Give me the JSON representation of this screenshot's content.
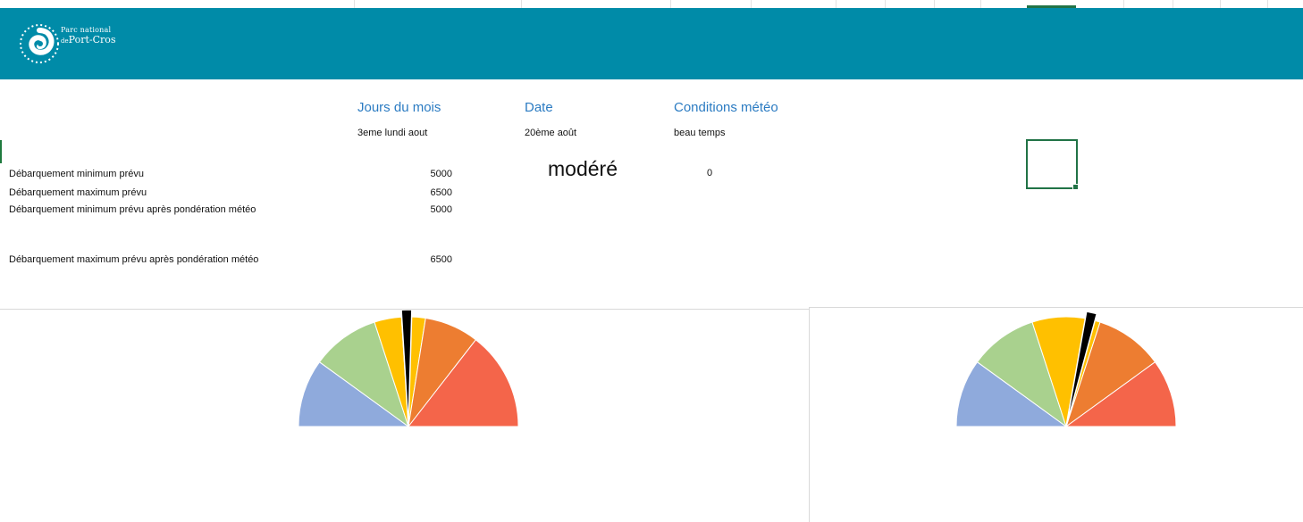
{
  "header": {
    "logo": {
      "line1": "Parc national",
      "line2_prefix": "de",
      "line2_name": "Port-Cros"
    }
  },
  "columns": {
    "days_header": "Jours du mois",
    "date_header": "Date",
    "weather_header": "Conditions météo",
    "days_value": "3eme  lundi aout",
    "date_value": "20ème août",
    "weather_value": "beau temps"
  },
  "rows": [
    {
      "label": "Débarquement minimum prévu",
      "value": "5000"
    },
    {
      "label": "Débarquement maximum prévu",
      "value": "6500"
    },
    {
      "label": "Débarquement minimum prévu après pondération météo",
      "value": "5000"
    },
    {
      "label": "Débarquement maximum prévu après pondération météo",
      "value": "6500"
    }
  ],
  "status": {
    "level_text": "modéré",
    "number": "0"
  },
  "colors": {
    "header_band": "#008ba8",
    "header_text": "#2b7bc2",
    "selection": "#217346",
    "gauge_blue": "#8faadc",
    "gauge_green": "#a9d18e",
    "gauge_yellow": "#ffc000",
    "gauge_orange": "#ed7d31",
    "gauge_red": "#f4654a",
    "needle": "#000000"
  },
  "chart_data": [
    {
      "type": "pie",
      "subtype": "half-donut-gauge",
      "segments": [
        {
          "color": "#8faadc",
          "value": 2
        },
        {
          "color": "#a9d18e",
          "value": 2
        },
        {
          "color": "#ffc000",
          "value": 0.8
        },
        {
          "color": "#ffc000",
          "value": 0.7
        },
        {
          "color": "#ed7d31",
          "value": 1.6
        },
        {
          "color": "#f4654a",
          "value": 2.9
        }
      ],
      "needle_value_fraction": 0.495
    },
    {
      "type": "pie",
      "subtype": "half-donut-gauge",
      "segments": [
        {
          "color": "#8faadc",
          "value": 2
        },
        {
          "color": "#a9d18e",
          "value": 2
        },
        {
          "color": "#ffc000",
          "value": 2
        },
        {
          "color": "#ed7d31",
          "value": 2
        },
        {
          "color": "#f4654a",
          "value": 2
        }
      ],
      "needle_value_fraction": 0.57
    }
  ]
}
